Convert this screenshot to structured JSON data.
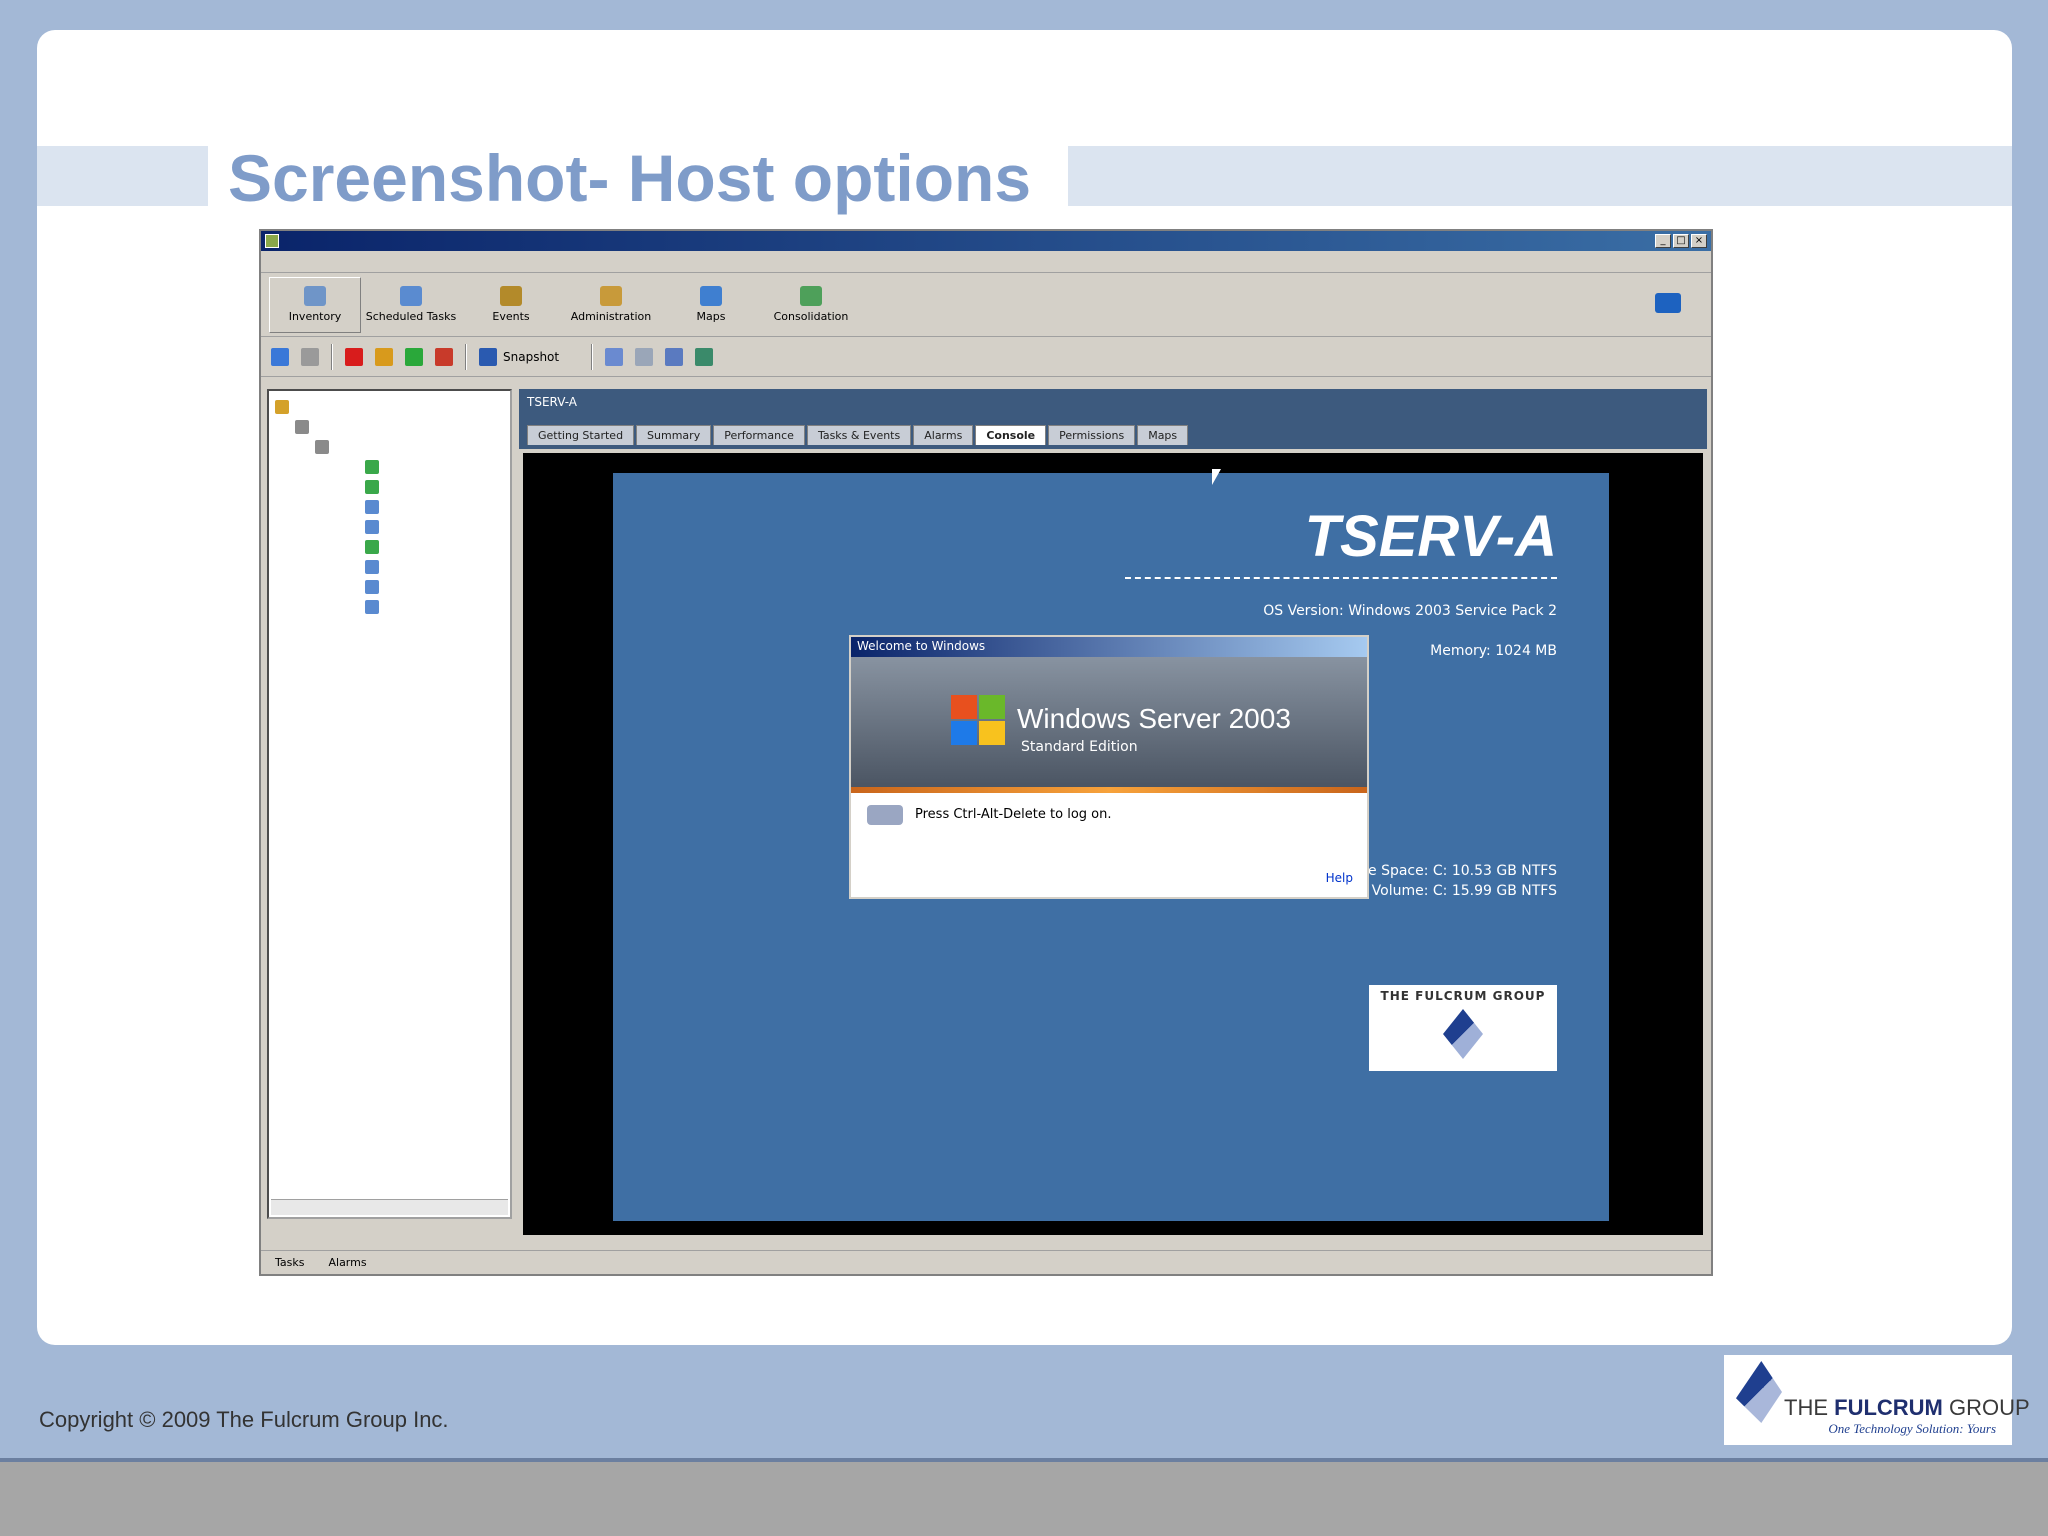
{
  "slide": {
    "title": "Screenshot- Host options",
    "copyright": "Copyright © 2009 The Fulcrum Group Inc.",
    "logo": {
      "name_prefix": "THE ",
      "name_bold": "FULCRUM",
      "name_suffix": " GROUP",
      "tagline": "One Technology Solution: Yours"
    }
  },
  "app": {
    "toolbar_buttons": [
      {
        "label": "Inventory",
        "icon": "inventory-icon"
      },
      {
        "label": "Scheduled Tasks",
        "icon": "scheduled-tasks-icon"
      },
      {
        "label": "Events",
        "icon": "events-icon"
      },
      {
        "label": "Administration",
        "icon": "administration-icon"
      },
      {
        "label": "Maps",
        "icon": "maps-icon"
      },
      {
        "label": "Consolidation",
        "icon": "consolidation-icon"
      }
    ],
    "toolbar2": {
      "snapshot_label": "Snapshot"
    },
    "vm_header": {
      "name": "TSERV-A"
    },
    "tabs": [
      "Getting Started",
      "Summary",
      "Performance",
      "Tasks & Events",
      "Alarms",
      "Console",
      "Permissions",
      "Maps"
    ],
    "active_tab": "Console",
    "statusbar": {
      "tasks": "Tasks",
      "alarms": "Alarms"
    }
  },
  "console": {
    "hostname": "TSERV-A",
    "info_lines": [
      "OS Version: Windows 2003 Service Pack 2",
      "",
      "Memory: 1024 MB",
      "",
      "",
      "",
      "",
      "",
      "",
      "",
      "",
      "",
      "",
      "",
      "Free Space: C: 10.53 GB NTFS",
      "Volume: C: 15.99 GB NTFS"
    ],
    "logo_title": "THE FULCRUM GROUP",
    "dialog": {
      "title": "Welcome to Windows",
      "product": "Windows Server 2003",
      "edition": "Standard Edition",
      "press_text": "Press Ctrl-Alt-Delete to log on.",
      "help": "Help"
    }
  }
}
